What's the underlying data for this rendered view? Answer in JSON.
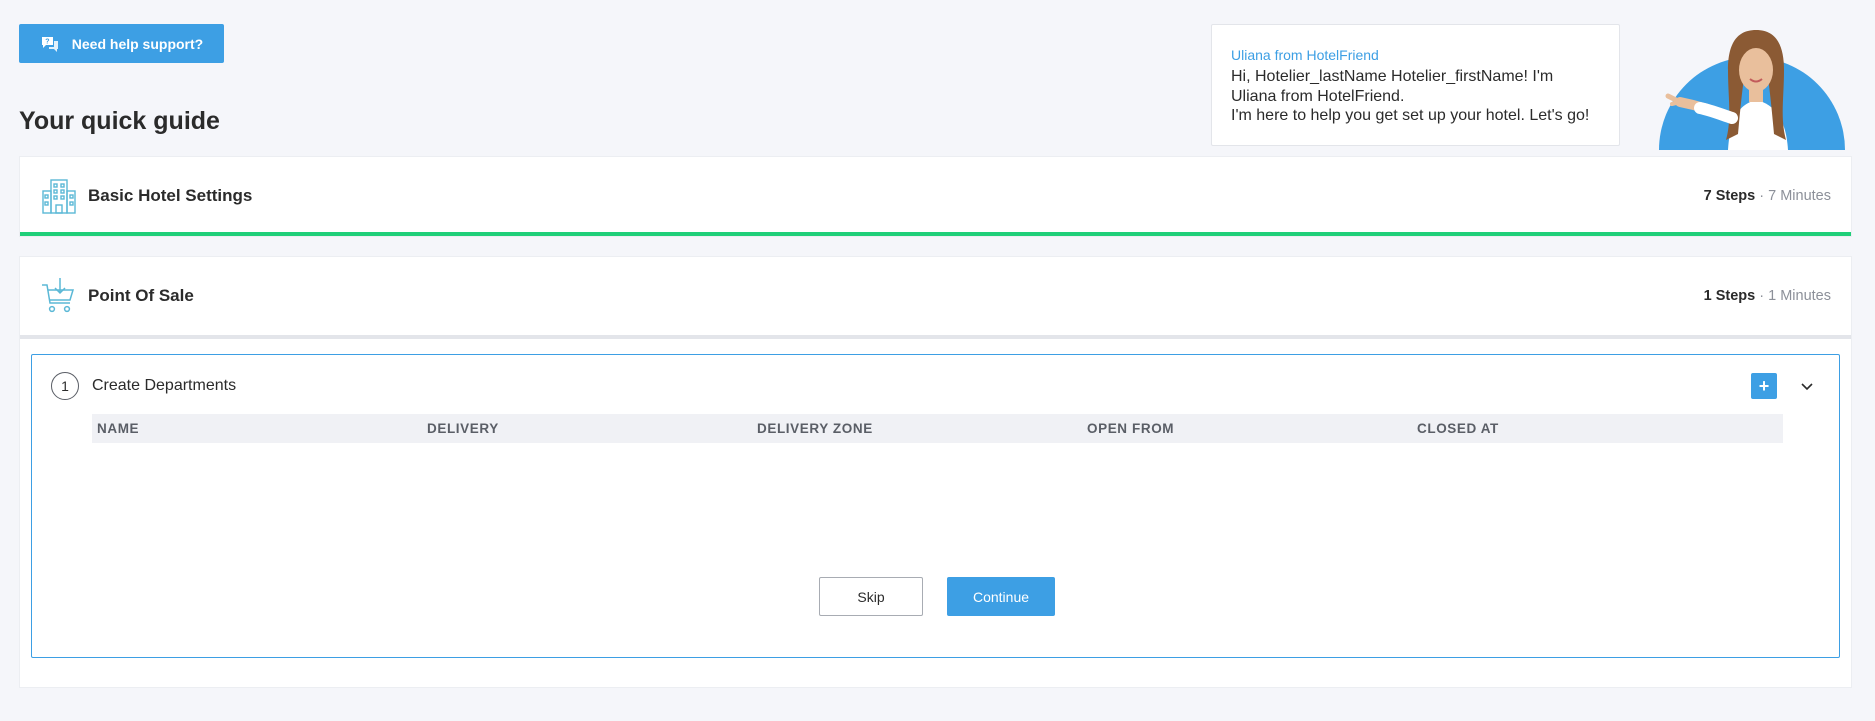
{
  "support": {
    "label": "Need help support?",
    "icon": "chat-help-icon"
  },
  "guide": {
    "title": "Your quick guide"
  },
  "assistant": {
    "from": "Uliana from HotelFriend",
    "message_line1": "Hi, Hotelier_lastName Hotelier_firstName! I'm",
    "message_line2": "Uliana from HotelFriend.",
    "message_line3": "I'm here to help you get set up your hotel. Let's go!"
  },
  "sections": [
    {
      "name": "Basic Hotel Settings",
      "steps": "7 Steps",
      "separator": " · ",
      "minutes": "7 Minutes",
      "icon": "building-icon",
      "progress_percent": 100
    },
    {
      "name": "Point Of Sale",
      "steps": "1 Steps",
      "separator": " · ",
      "minutes": "1 Minutes",
      "icon": "cart-icon"
    }
  ],
  "step": {
    "number": "1",
    "title": "Create Departments",
    "add_label": "+",
    "columns": [
      "NAME",
      "DELIVERY",
      "DELIVERY ZONE",
      "OPEN FROM",
      "CLOSED AT"
    ],
    "skip_label": "Skip",
    "continue_label": "Continue"
  },
  "colors": {
    "accent": "#3d9fe4",
    "progress": "#1fcf79",
    "icon": "#5bb8d6"
  }
}
